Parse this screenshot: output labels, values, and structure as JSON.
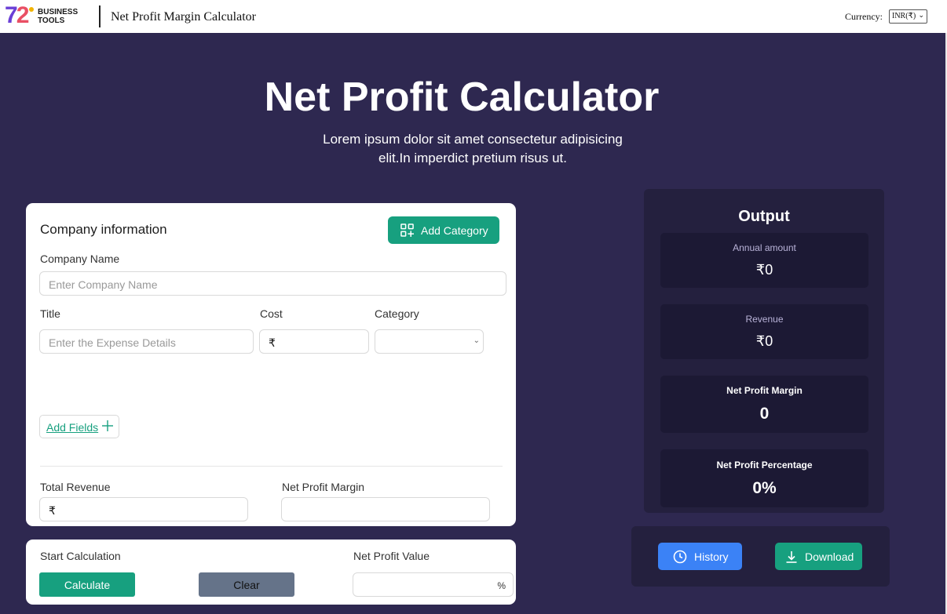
{
  "header": {
    "logo_number": "72",
    "logo_text_line1": "BUSINESS",
    "logo_text_line2": "TOOLS",
    "app_title": "Net Profit Margin Calculator",
    "currency_label": "Currency:",
    "currency_value": "INR(₹)"
  },
  "hero": {
    "title": "Net Profit Calculator",
    "subtitle": "Lorem ipsum dolor sit amet consectetur adipisicing elit.In imperdict pretium risus ut."
  },
  "company": {
    "section_title": "Company information",
    "add_category_label": "Add Category",
    "company_name_label": "Company Name",
    "company_name_placeholder": "Enter Company Name",
    "title_label": "Title",
    "cost_label": "Cost",
    "category_label": "Category",
    "expense_placeholder": "Enter the Expense Details",
    "currency_symbol": "₹",
    "add_fields_label": "Add Fields",
    "total_revenue_label": "Total Revenue",
    "net_profit_margin_label": "Net Profit Margin"
  },
  "calc": {
    "start_label": "Start Calculation",
    "calculate_label": "Calculate",
    "clear_label": "Clear",
    "net_profit_value_label": "Net Profit Value",
    "percent_symbol": "%"
  },
  "output": {
    "title": "Output",
    "items": [
      {
        "name": "Annual amount",
        "value": "₹0"
      },
      {
        "name": "Revenue",
        "value": "₹0"
      },
      {
        "name": "Net Profit Margin",
        "value": "0"
      },
      {
        "name": "Net Profit Percentage",
        "value": "0%"
      }
    ]
  },
  "actions": {
    "history_label": "History",
    "download_label": "Download"
  },
  "colors": {
    "background": "#2e2850",
    "panel": "#24203e",
    "accent_green": "#17a07f",
    "accent_blue": "#3b82f6",
    "clear_gray": "#657389"
  }
}
